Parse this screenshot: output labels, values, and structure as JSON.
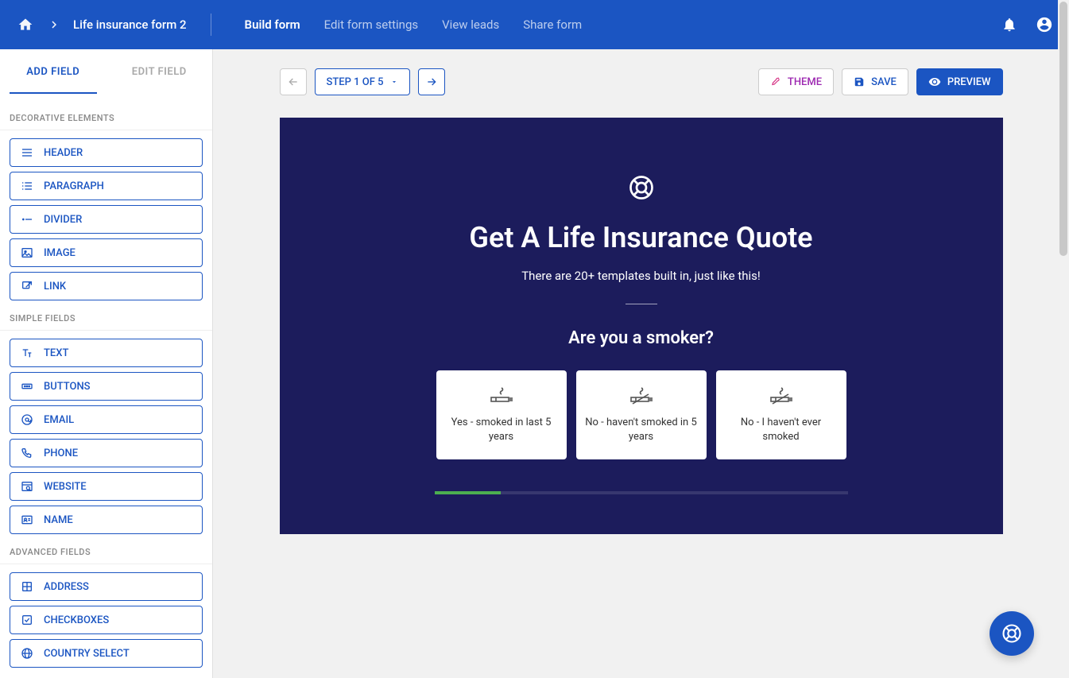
{
  "header": {
    "form_title": "Life insurance form 2",
    "tabs": [
      {
        "label": "Build form",
        "active": true
      },
      {
        "label": "Edit form settings",
        "active": false
      },
      {
        "label": "View leads",
        "active": false
      },
      {
        "label": "Share form",
        "active": false
      }
    ]
  },
  "sidebar": {
    "tabs": {
      "add": "ADD FIELD",
      "edit": "EDIT FIELD"
    },
    "sections": [
      {
        "title": "DECORATIVE ELEMENTS",
        "items": [
          {
            "label": "HEADER",
            "icon": "header"
          },
          {
            "label": "PARAGRAPH",
            "icon": "paragraph"
          },
          {
            "label": "DIVIDER",
            "icon": "divider"
          },
          {
            "label": "IMAGE",
            "icon": "image"
          },
          {
            "label": "LINK",
            "icon": "link"
          }
        ]
      },
      {
        "title": "SIMPLE FIELDS",
        "items": [
          {
            "label": "TEXT",
            "icon": "text"
          },
          {
            "label": "BUTTONS",
            "icon": "buttons"
          },
          {
            "label": "EMAIL",
            "icon": "email"
          },
          {
            "label": "PHONE",
            "icon": "phone"
          },
          {
            "label": "WEBSITE",
            "icon": "website"
          },
          {
            "label": "NAME",
            "icon": "name"
          }
        ]
      },
      {
        "title": "ADVANCED FIELDS",
        "items": [
          {
            "label": "ADDRESS",
            "icon": "address"
          },
          {
            "label": "CHECKBOXES",
            "icon": "checkbox"
          },
          {
            "label": "COUNTRY SELECT",
            "icon": "country"
          }
        ]
      }
    ]
  },
  "toolbar": {
    "step_label": "STEP 1 OF 5",
    "theme": "THEME",
    "save": "SAVE",
    "preview": "PREVIEW"
  },
  "form": {
    "heading": "Get A Life Insurance Quote",
    "subheading": "There are 20+ templates built in, just like this!",
    "question": "Are you a smoker?",
    "options": [
      {
        "label": "Yes - smoked in last 5 years",
        "icon": "smoke"
      },
      {
        "label": "No - haven't smoked in 5 years",
        "icon": "no-smoke"
      },
      {
        "label": "No - I haven't ever smoked",
        "icon": "no-smoke"
      }
    ],
    "progress_percent": 16
  },
  "colors": {
    "brand": "#1b55c2",
    "form_bg": "#1c1c5c",
    "progress": "#4caf50"
  }
}
